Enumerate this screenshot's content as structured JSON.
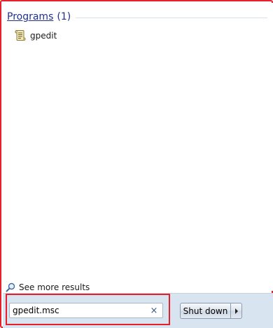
{
  "results": {
    "group_title": "Programs",
    "group_count": "(1)",
    "items": [
      {
        "label": "gpedit",
        "icon": "script-file-icon"
      }
    ],
    "see_more_label": "See more results"
  },
  "search": {
    "value": "gpedit.msc",
    "clear_glyph": "×"
  },
  "power": {
    "shutdown_label": "Shut down",
    "arrow_icon": "triangle-right-icon"
  },
  "colors": {
    "highlight_red": "#e5202b",
    "header_blue": "#1e3287",
    "bottom_bar": "#d9e4f1"
  }
}
